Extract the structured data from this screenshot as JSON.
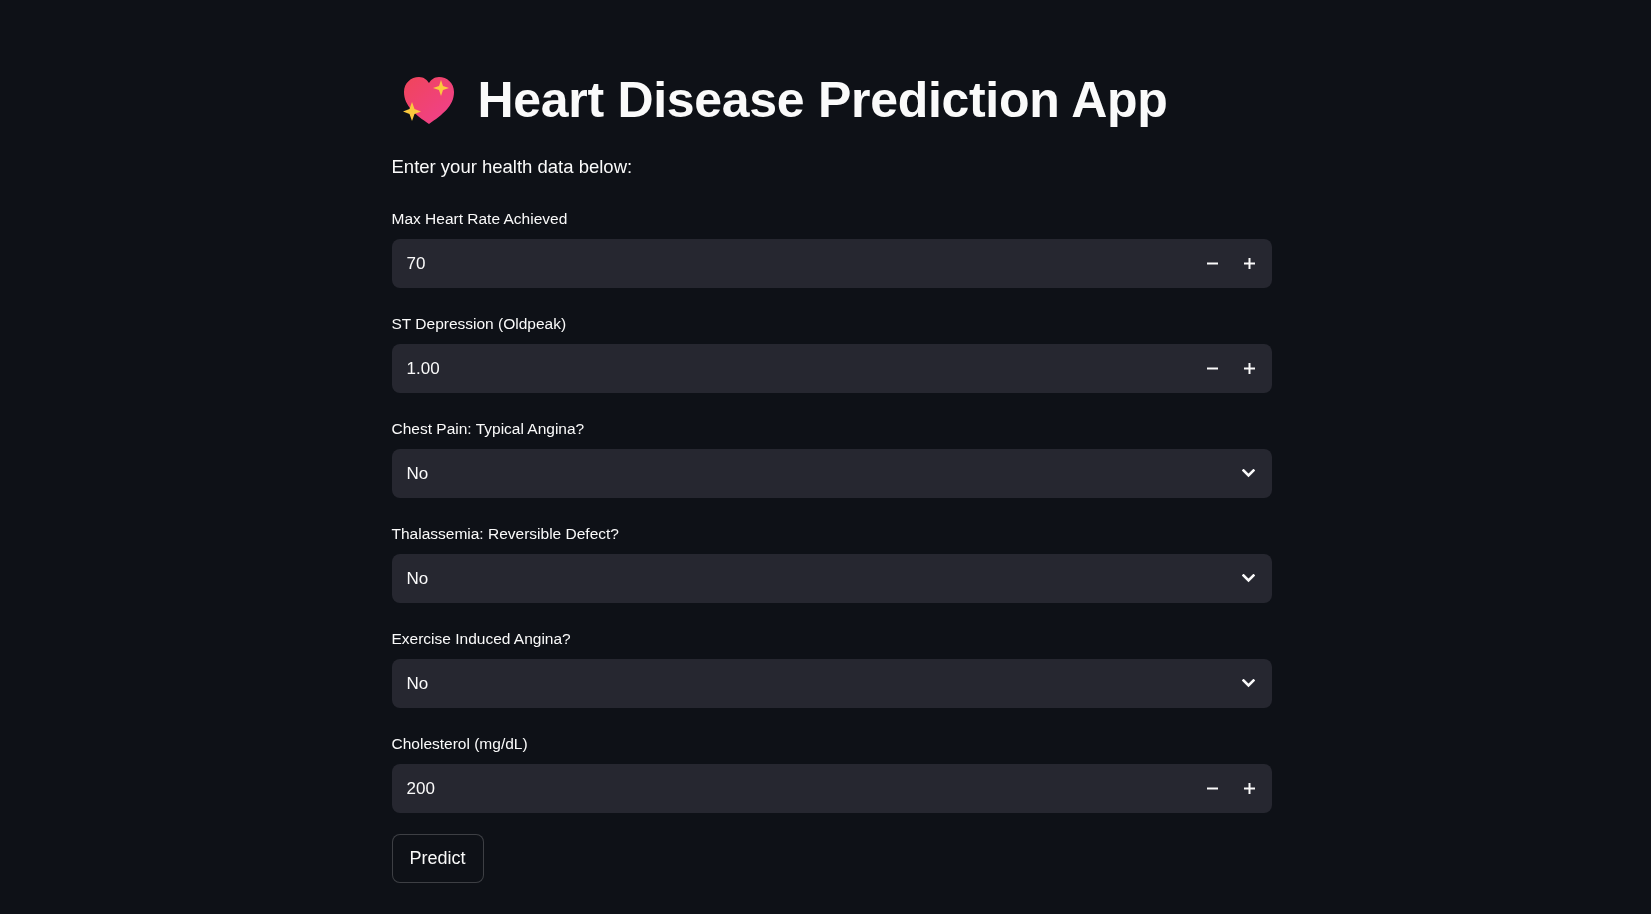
{
  "title": "Heart Disease Prediction App",
  "subtitle": "Enter your health data below:",
  "fields": [
    {
      "kind": "number",
      "label": "Max Heart Rate Achieved",
      "value": "70"
    },
    {
      "kind": "number",
      "label": "ST Depression (Oldpeak)",
      "value": "1.00"
    },
    {
      "kind": "select",
      "label": "Chest Pain: Typical Angina?",
      "value": "No"
    },
    {
      "kind": "select",
      "label": "Thalassemia: Reversible Defect?",
      "value": "No"
    },
    {
      "kind": "select",
      "label": "Exercise Induced Angina?",
      "value": "No"
    },
    {
      "kind": "number",
      "label": "Cholesterol (mg/dL)",
      "value": "200"
    }
  ],
  "buttons": [
    "Predict"
  ]
}
